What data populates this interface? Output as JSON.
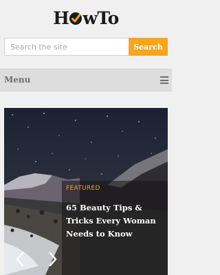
{
  "header": {
    "logo_prefix": "H",
    "logo_suffix": "wTo"
  },
  "search": {
    "placeholder": "Search the site",
    "button_label": "Search"
  },
  "menu": {
    "label": "Menu"
  },
  "featured": {
    "label": "FEATURED",
    "title": "65 Beauty Tips & Tricks Every Woman Needs to Know"
  },
  "colors": {
    "accent": "#f7a51c",
    "page_bg": "#f0f0f0",
    "menu_bg": "#dddddd"
  },
  "icons": {
    "logo_mark": "check-circle-icon",
    "menu": "hamburger-icon",
    "prev": "chevron-left-icon",
    "next": "chevron-right-icon"
  }
}
